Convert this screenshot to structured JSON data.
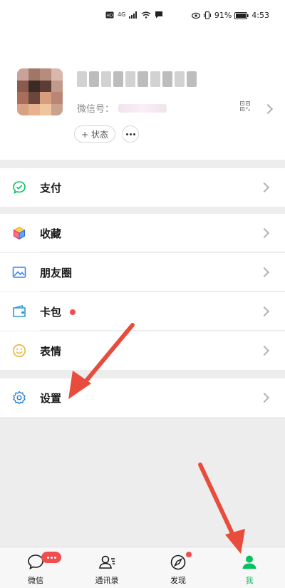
{
  "status_bar": {
    "network": "4G",
    "battery": "91%",
    "time": "4:53"
  },
  "profile": {
    "wechat_id_label": "微信号：",
    "status_button": "+ 状态"
  },
  "menu": [
    {
      "label": "支付",
      "icon": "pay-icon"
    },
    {
      "label": "收藏",
      "icon": "favorites-icon"
    },
    {
      "label": "朋友圈",
      "icon": "moments-icon"
    },
    {
      "label": "卡包",
      "icon": "cards-icon"
    },
    {
      "label": "表情",
      "icon": "stickers-icon"
    },
    {
      "label": "设置",
      "icon": "settings-icon"
    }
  ],
  "tabs": [
    {
      "label": "微信",
      "icon": "chat-icon"
    },
    {
      "label": "通讯录",
      "icon": "contacts-icon"
    },
    {
      "label": "发现",
      "icon": "discover-icon"
    },
    {
      "label": "我",
      "icon": "me-icon"
    }
  ],
  "colors": {
    "accent": "#07c160",
    "badge": "#f04e4e",
    "annotation_arrow": "#e84c3d"
  }
}
